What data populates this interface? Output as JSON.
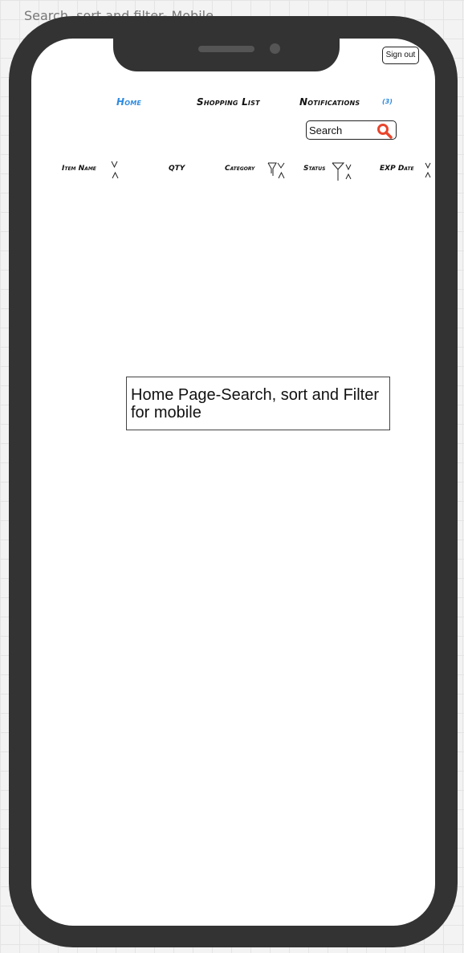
{
  "canvas": {
    "title": "Search, sort and filter- Mobile"
  },
  "header": {
    "signout_label": "Sign out"
  },
  "nav": {
    "items": [
      {
        "label": "Home",
        "active": true,
        "color": "#2e8be0"
      },
      {
        "label": "Shopping List",
        "active": false
      },
      {
        "label": "Notifications",
        "active": false
      }
    ],
    "notifications_count": "(3)"
  },
  "search": {
    "placeholder": "Search",
    "value": "",
    "icon": "search-icon",
    "icon_color": "#e8452c"
  },
  "table": {
    "columns": [
      {
        "label": "Item Name",
        "controls": [
          "sort-down-icon",
          "sort-up-icon"
        ]
      },
      {
        "label": "QTY",
        "controls": []
      },
      {
        "label": "Category",
        "controls": [
          "filter-icon",
          "sort-down-icon",
          "sort-up-icon"
        ]
      },
      {
        "label": "Status",
        "controls": [
          "filter-icon",
          "sort-down-icon",
          "sort-up-icon"
        ]
      },
      {
        "label": "EXP Date",
        "controls": [
          "sort-down-icon",
          "sort-up-icon"
        ]
      }
    ]
  },
  "annotation": {
    "text": "Home Page-Search, sort and Filter for mobile"
  },
  "colors": {
    "device": "#333333",
    "accent": "#2e8be0"
  }
}
